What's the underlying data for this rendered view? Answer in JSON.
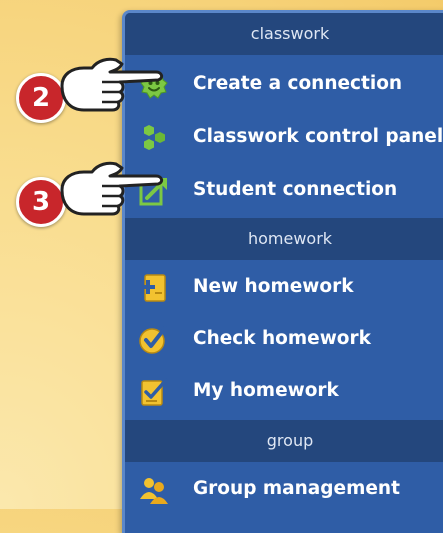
{
  "sections": [
    {
      "header": "classwork",
      "items": [
        {
          "label": "Create a connection",
          "icon": "green-smiley-icon"
        },
        {
          "label": "Classwork control panel",
          "icon": "green-hexagons-icon"
        },
        {
          "label": "Student connection",
          "icon": "green-arrow-square-icon"
        }
      ]
    },
    {
      "header": "homework",
      "items": [
        {
          "label": "New homework",
          "icon": "new-document-icon"
        },
        {
          "label": "Check homework",
          "icon": "checkmark-circle-icon"
        },
        {
          "label": "My homework",
          "icon": "checklist-icon"
        }
      ]
    },
    {
      "header": "group",
      "items": [
        {
          "label": "Group management",
          "icon": "people-group-icon"
        }
      ]
    }
  ],
  "callouts": [
    "2",
    "3"
  ],
  "colors": {
    "menu_bg": "#2f5da6",
    "header_bg": "#24477d",
    "badge": "#c8262b",
    "icon_green": "#7cc843"
  }
}
